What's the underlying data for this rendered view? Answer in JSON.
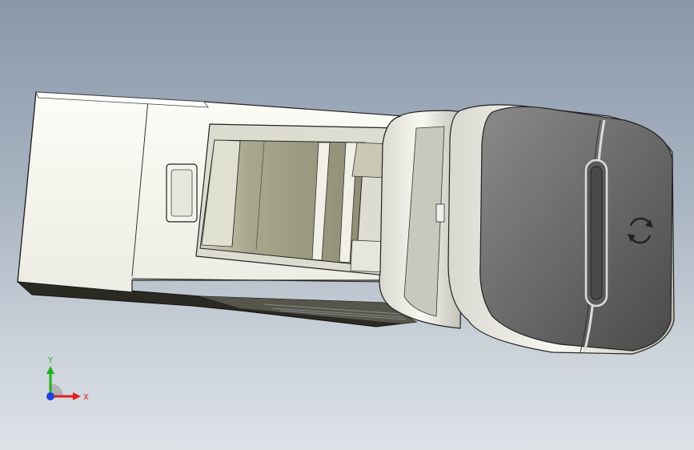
{
  "viewport": {
    "background_top": "#8a98aa",
    "background_bottom": "#dde2e7"
  },
  "model": {
    "body_color": "#f4f4ee",
    "shadow_color": "#2a2a22",
    "cap_color": "#6a6a6a",
    "slot_color": "#b4b49a",
    "cap_symbol": "refresh-icon"
  },
  "triad": {
    "x_label": "X",
    "y_label": "Y",
    "x_color": "#e02020",
    "y_color": "#20b020",
    "z_color": "#2040e0"
  }
}
